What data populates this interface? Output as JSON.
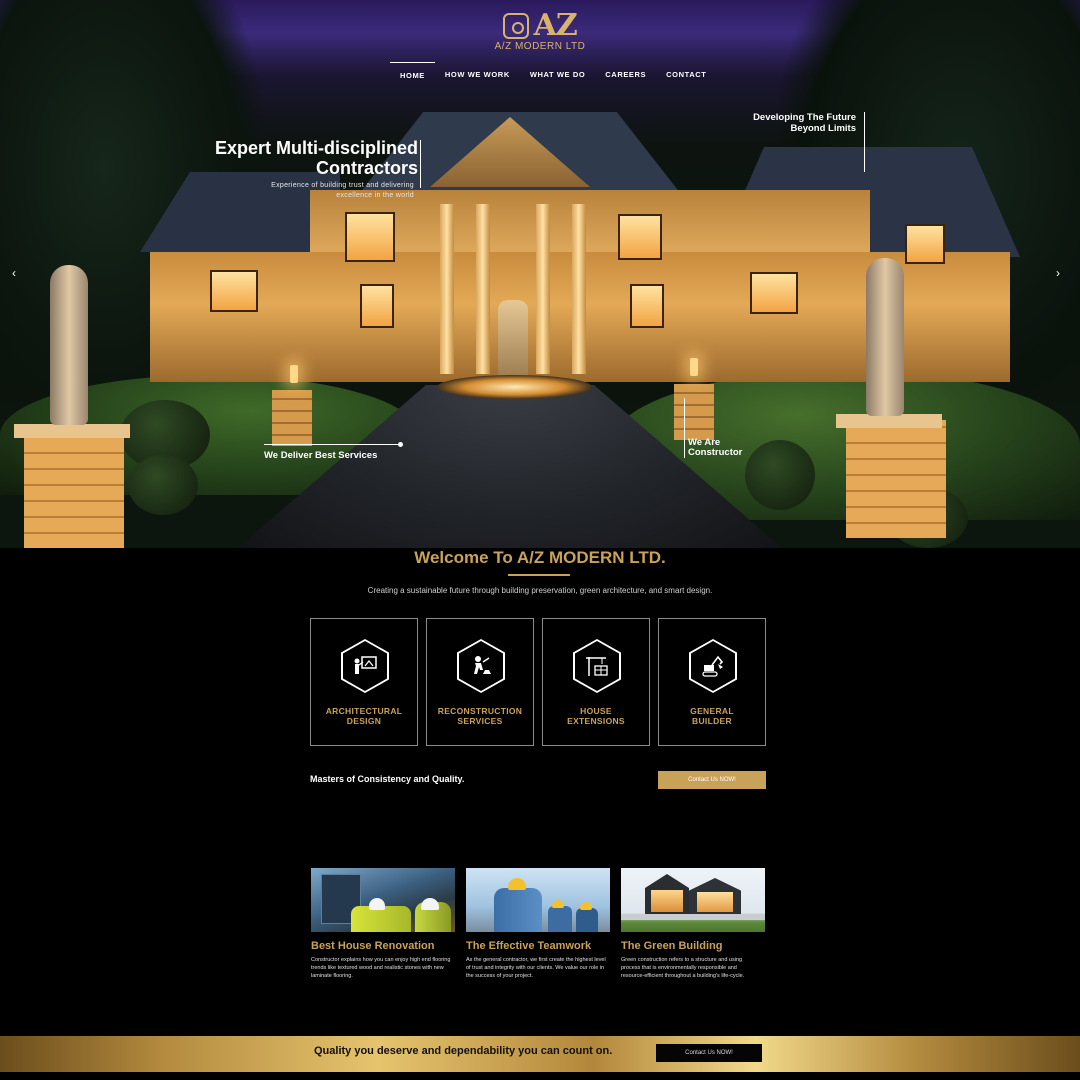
{
  "brand": {
    "logo_letters": "AZ",
    "logo_sub": "A/Z MODERN LTD"
  },
  "nav": {
    "items": [
      "HOME",
      "HOW WE WORK",
      "WHAT WE DO",
      "CAREERS",
      "CONTACT"
    ],
    "active": "HOME"
  },
  "hero": {
    "title_line1": "Expert Multi-disciplined",
    "title_line2": "Contractors",
    "subtitle_line1": "Experience of building trust and delivering",
    "subtitle_line2": "excellence in the world",
    "right_line1": "Developing The Future",
    "right_line2": "Beyond Limits",
    "deliver": "We Deliver Best Services",
    "constructor_line1": "We Are",
    "constructor_line2": "Constructor",
    "prev_arrow": "‹",
    "next_arrow": "›"
  },
  "welcome": {
    "title": "Welcome To A/Z MODERN LTD.",
    "subtitle": "Creating a sustainable future through building preservation, green architecture, and smart design."
  },
  "services": [
    {
      "line1": "ARCHITECTURAL",
      "line2": "DESIGN",
      "icon": "architect-icon"
    },
    {
      "line1": "RECONSTRUCTION",
      "line2": "SERVICES",
      "icon": "worker-icon"
    },
    {
      "line1": "HOUSE",
      "line2": "EXTENSIONS",
      "icon": "crane-icon"
    },
    {
      "line1": "GENERAL",
      "line2": "BUILDER",
      "icon": "excavator-icon"
    }
  ],
  "cta": {
    "masters": "Masters of Consistency and Quality.",
    "button": "Contact Us NOW!"
  },
  "cards": [
    {
      "title": "Best House Renovation",
      "text": "Constructor explains how you can enjoy high end flooring trends like textured wood and realistic stones with new laminate flooring."
    },
    {
      "title": "The Effective Teamwork",
      "text": "As the general contractor, we first create the highest level of trust and integrity with our clients. We value our role in the success of your project."
    },
    {
      "title": "The Green Building",
      "text": "Green construction refers to a structure and using process that is environmentally responsible and resource-efficient throughout a building's life-cycle."
    }
  ],
  "bottom": {
    "text": "Quality you deserve and dependability you can count on.",
    "button": "Contact Us NOW!"
  },
  "colors": {
    "gold": "#c9a25a",
    "background": "#000000",
    "text": "#ffffff"
  }
}
